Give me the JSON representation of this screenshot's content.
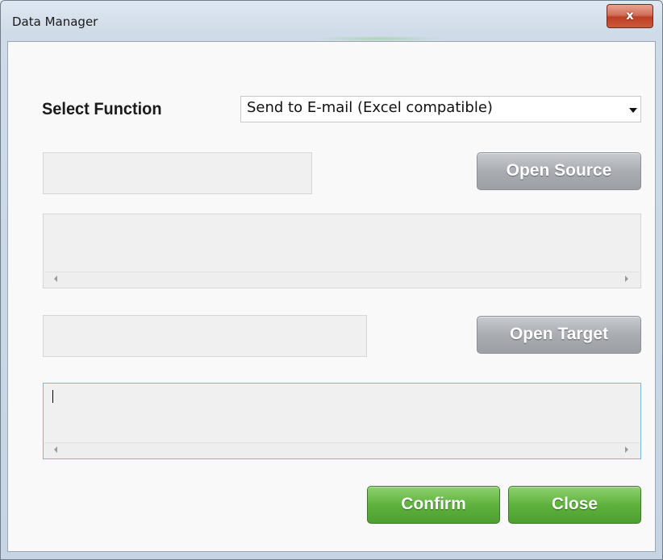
{
  "window": {
    "title": "Data Manager",
    "close_glyph": "x"
  },
  "form": {
    "select_label": "Select Function",
    "function_value": "Send to E-mail (Excel compatible)",
    "source_path": "",
    "target_path": "",
    "source_content": "",
    "target_content": ""
  },
  "buttons": {
    "open_source": "Open Source",
    "open_target": "Open Target",
    "confirm": "Confirm",
    "close": "Close"
  },
  "colors": {
    "close_button": "#c74a2f",
    "gray_button": "#a9adb2",
    "green_button": "#5fb23d"
  },
  "icons": [
    "close-icon",
    "dropdown-arrow-icon",
    "scroll-left-arrow-icon",
    "scroll-right-arrow-icon"
  ]
}
